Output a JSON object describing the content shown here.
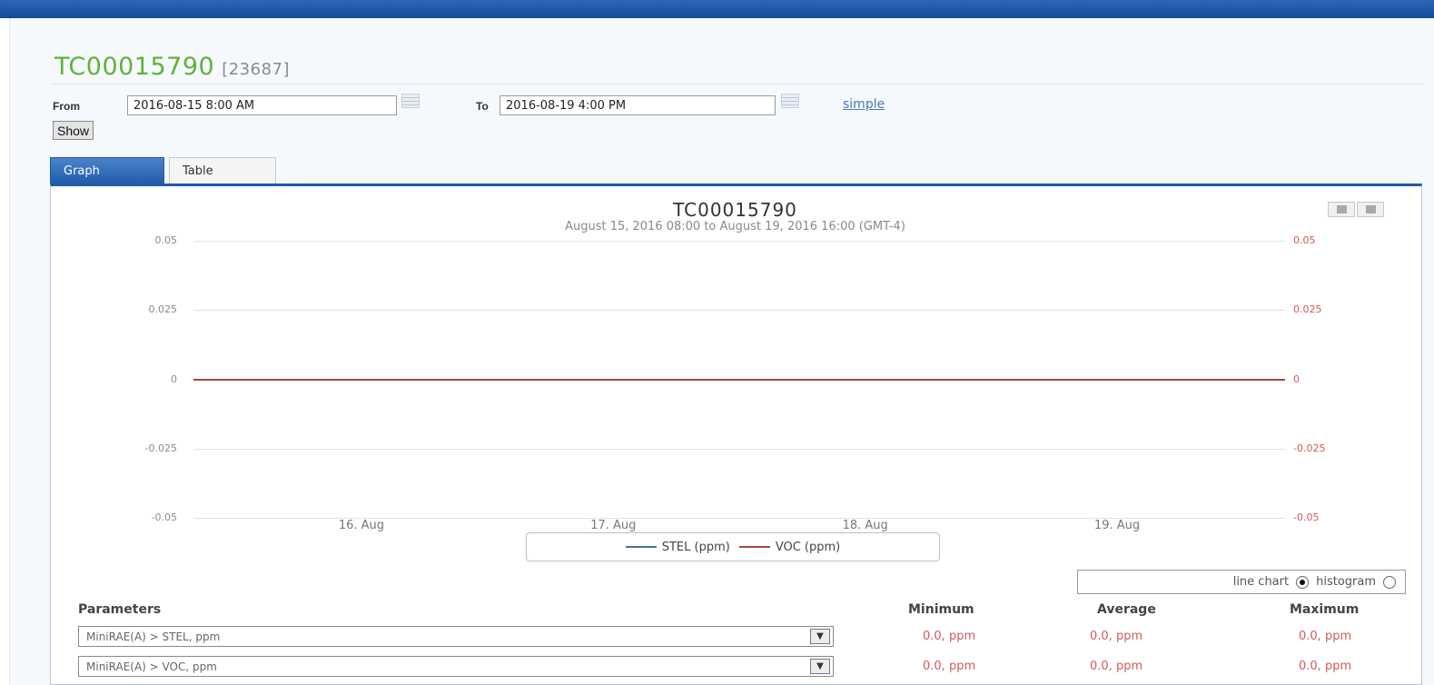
{
  "header": {
    "device_name": "TC00015790",
    "device_id": "[23687]"
  },
  "filter": {
    "from_label": "From",
    "from_value": "2016-08-15 8:00 AM",
    "to_label": "To",
    "to_value": "2016-08-19 4:00 PM",
    "simple_link": "simple",
    "show_button": "Show"
  },
  "tabs": [
    {
      "label": "Graph",
      "active": true
    },
    {
      "label": "Table",
      "active": false
    }
  ],
  "chart_data": {
    "type": "line",
    "title": "TC00015790",
    "subtitle": "August 15, 2016 08:00 to August 19, 2016 16:00 (GMT-4)",
    "y_left_ticks": [
      "0.05",
      "0.025",
      "0",
      "-0.025",
      "-0.05"
    ],
    "y_right_ticks": [
      "0.05",
      "0.025",
      "0",
      "-0.025",
      "-0.05"
    ],
    "ylim": [
      -0.05,
      0.05
    ],
    "x_tick_labels": [
      "16. Aug",
      "17. Aug",
      "18. Aug",
      "19. Aug"
    ],
    "x_range": [
      "2016-08-15 08:00",
      "2016-08-19 16:00"
    ],
    "x_ticks": [
      "2016-08-16 00:00",
      "2016-08-17 00:00",
      "2016-08-18 00:00",
      "2016-08-19 00:00"
    ],
    "grid": true,
    "legend_position": "bottom-center",
    "series": [
      {
        "name": "STEL (ppm)",
        "color": "#4572a7",
        "x": [
          "2016-08-15 08:00",
          "2016-08-19 16:00"
        ],
        "y": [
          0,
          0
        ]
      },
      {
        "name": "VOC (ppm)",
        "color": "#aa4643",
        "x": [
          "2016-08-15 08:00",
          "2016-08-19 16:00"
        ],
        "y": [
          0,
          0
        ]
      }
    ]
  },
  "chart_mode": {
    "line_label": "line chart",
    "histogram_label": "histogram",
    "selected": "line chart"
  },
  "parameters": {
    "heading": "Parameters",
    "col_min": "Minimum",
    "col_avg": "Average",
    "col_max": "Maximum",
    "rows": [
      {
        "name": "MiniRAE(A) > STEL, ppm",
        "min": "0.0, ppm",
        "avg": "0.0, ppm",
        "max": "0.0, ppm"
      },
      {
        "name": "MiniRAE(A) > VOC, ppm",
        "min": "0.0, ppm",
        "avg": "0.0, ppm",
        "max": "0.0, ppm"
      }
    ]
  },
  "colors": {
    "accent": "#1f5aa8",
    "title_green": "#5fb33a",
    "stat_red": "#d05a5a"
  }
}
